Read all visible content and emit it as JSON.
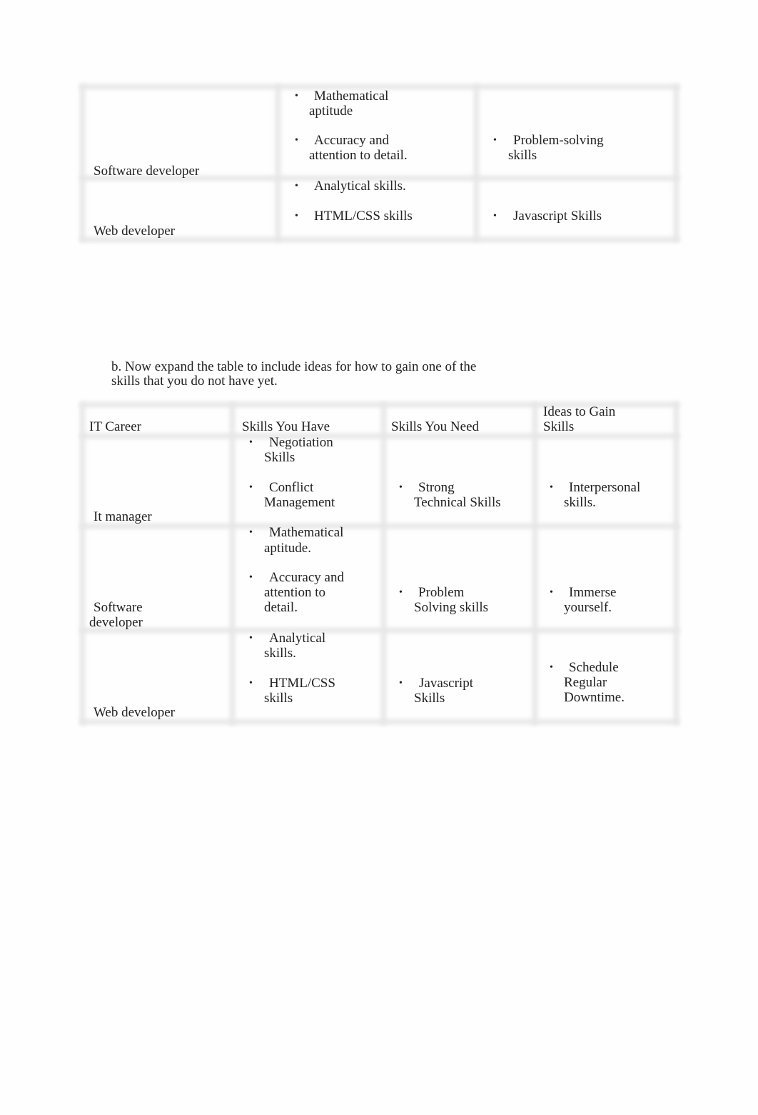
{
  "table1": {
    "rows": [
      {
        "career": "Software developer",
        "have": [
          {
            "first": "Mathematical",
            "rest": "aptitude"
          },
          {
            "first": "Accuracy and",
            "rest": "attention to detail."
          },
          {
            "first": "Analytical skills.",
            "rest": ""
          }
        ],
        "need": [
          {
            "first": "Problem-solving",
            "rest": "skills"
          }
        ]
      },
      {
        "career": "Web developer",
        "have": [
          {
            "first": "HTML/CSS skills",
            "rest": ""
          }
        ],
        "need": [
          {
            "first": "Javascript Skills",
            "rest": ""
          }
        ]
      }
    ]
  },
  "instruction": {
    "line1": "b. Now expand the table to include ideas for how to gain one of the",
    "line2": "skills that you do not have yet."
  },
  "table2": {
    "headers": [
      "IT Career",
      "Skills You Have",
      "Skills You Need",
      "Ideas to Gain",
      "Skills"
    ],
    "rows": [
      {
        "career": [
          "It manager"
        ],
        "have": [
          {
            "first": "Negotiation",
            "rest": "Skills"
          },
          {
            "first": "Conflict",
            "rest": "Management"
          }
        ],
        "need": [
          {
            "first": "Strong",
            "rest": "Technical Skills"
          }
        ],
        "ideas": [
          {
            "first": "Interpersonal",
            "rest": "skills."
          }
        ]
      },
      {
        "career": [
          "Software",
          "developer"
        ],
        "have": [
          {
            "first": "Mathematical",
            "rest": "aptitude."
          },
          {
            "first": "Accuracy and",
            "rest": "attention to\ndetail."
          }
        ],
        "need": [
          {
            "first": "Problem",
            "rest": "Solving skills"
          }
        ],
        "ideas": [
          {
            "first": "Immerse",
            "rest": "yourself."
          }
        ]
      },
      {
        "career": [
          "Web developer"
        ],
        "have": [
          {
            "first": "Analytical",
            "rest": "skills."
          },
          {
            "first": "HTML/CSS",
            "rest": "skills"
          }
        ],
        "need": [
          {
            "first": " Javascript",
            "rest": "Skills"
          }
        ],
        "ideas": [
          {
            "first": "Schedule",
            "rest": "Regular\nDowntime."
          }
        ]
      }
    ]
  },
  "bullet_glyph": "•"
}
